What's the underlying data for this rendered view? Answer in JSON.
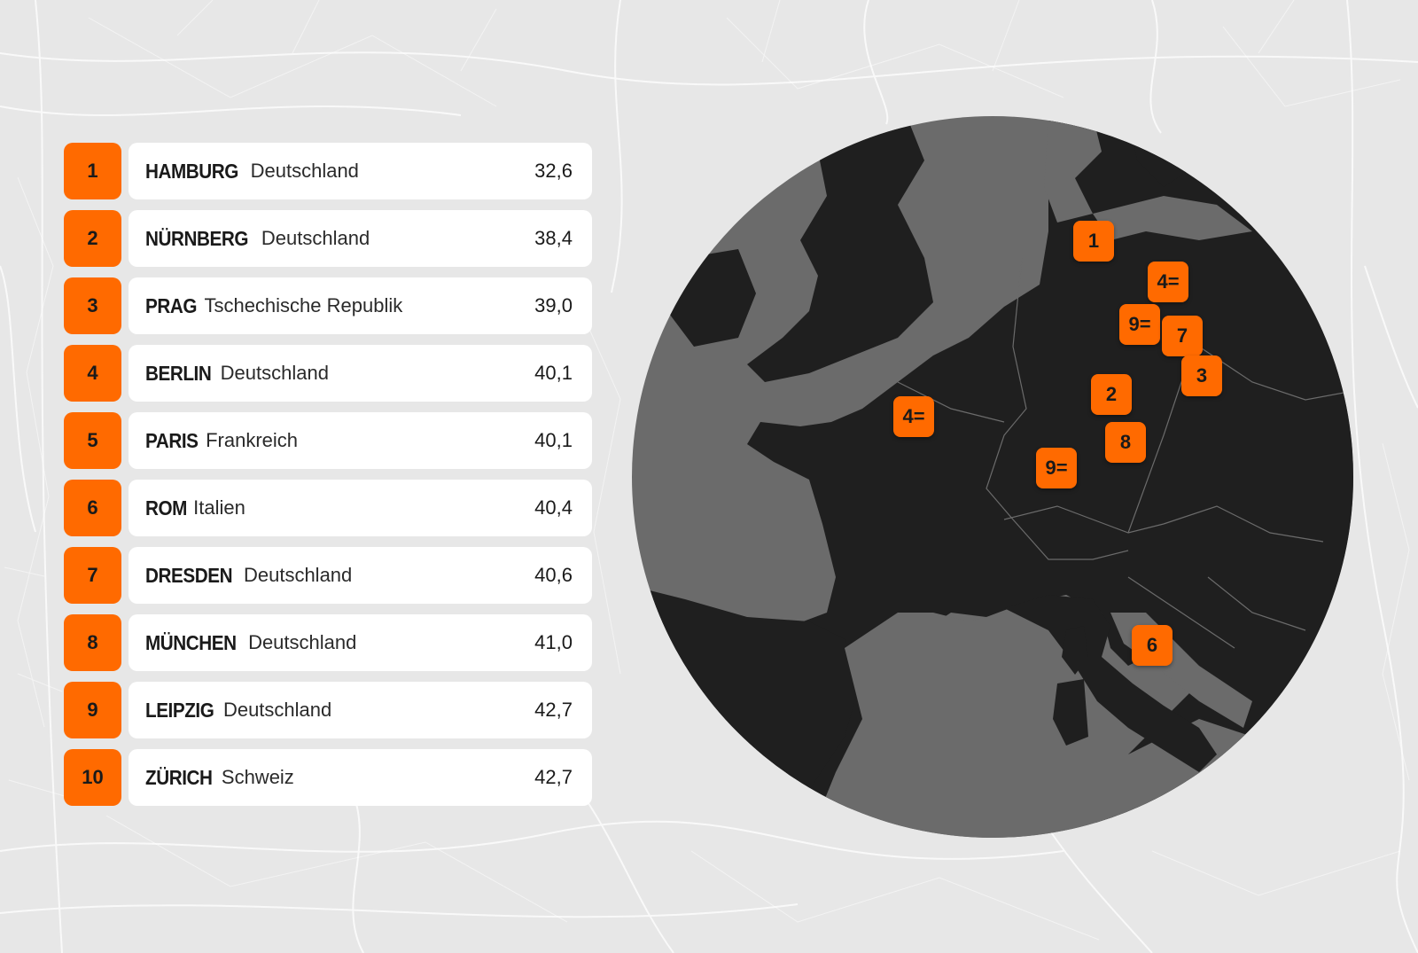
{
  "ranking": [
    {
      "rank": "1",
      "city": "HAMBURG",
      "country": "Deutschland",
      "value": "32,6"
    },
    {
      "rank": "2",
      "city": "NÜRNBERG",
      "country": "Deutschland",
      "value": "38,4"
    },
    {
      "rank": "3",
      "city": "PRAG",
      "country": "Tschechische Republik",
      "value": "39,0"
    },
    {
      "rank": "4",
      "city": "BERLIN",
      "country": "Deutschland",
      "value": "40,1"
    },
    {
      "rank": "5",
      "city": "PARIS",
      "country": "Frankreich",
      "value": "40,1"
    },
    {
      "rank": "6",
      "city": "ROM",
      "country": "Italien",
      "value": "40,4"
    },
    {
      "rank": "7",
      "city": "DRESDEN",
      "country": "Deutschland",
      "value": "40,6"
    },
    {
      "rank": "8",
      "city": "MÜNCHEN",
      "country": "Deutschland",
      "value": "41,0"
    },
    {
      "rank": "9",
      "city": "LEIPZIG",
      "country": "Deutschland",
      "value": "42,7"
    },
    {
      "rank": "10",
      "city": "ZÜRICH",
      "country": "Schweiz",
      "value": "42,7"
    }
  ],
  "map_markers": [
    {
      "label": "1",
      "city": "HAMBURG"
    },
    {
      "label": "4=",
      "city": "BERLIN"
    },
    {
      "label": "9=",
      "city": "LEIPZIG"
    },
    {
      "label": "7",
      "city": "DRESDEN"
    },
    {
      "label": "3",
      "city": "PRAG"
    },
    {
      "label": "2",
      "city": "NÜRNBERG"
    },
    {
      "label": "8",
      "city": "MÜNCHEN"
    },
    {
      "label": "4=",
      "city": "PARIS"
    },
    {
      "label": "9=",
      "city": "ZÜRICH"
    },
    {
      "label": "6",
      "city": "ROM"
    }
  ],
  "colors": {
    "accent": "#ff6a00",
    "background": "#e7e7e7",
    "sea": "#6b6b6b",
    "land": "#1f1f1f",
    "card": "#ffffff"
  }
}
